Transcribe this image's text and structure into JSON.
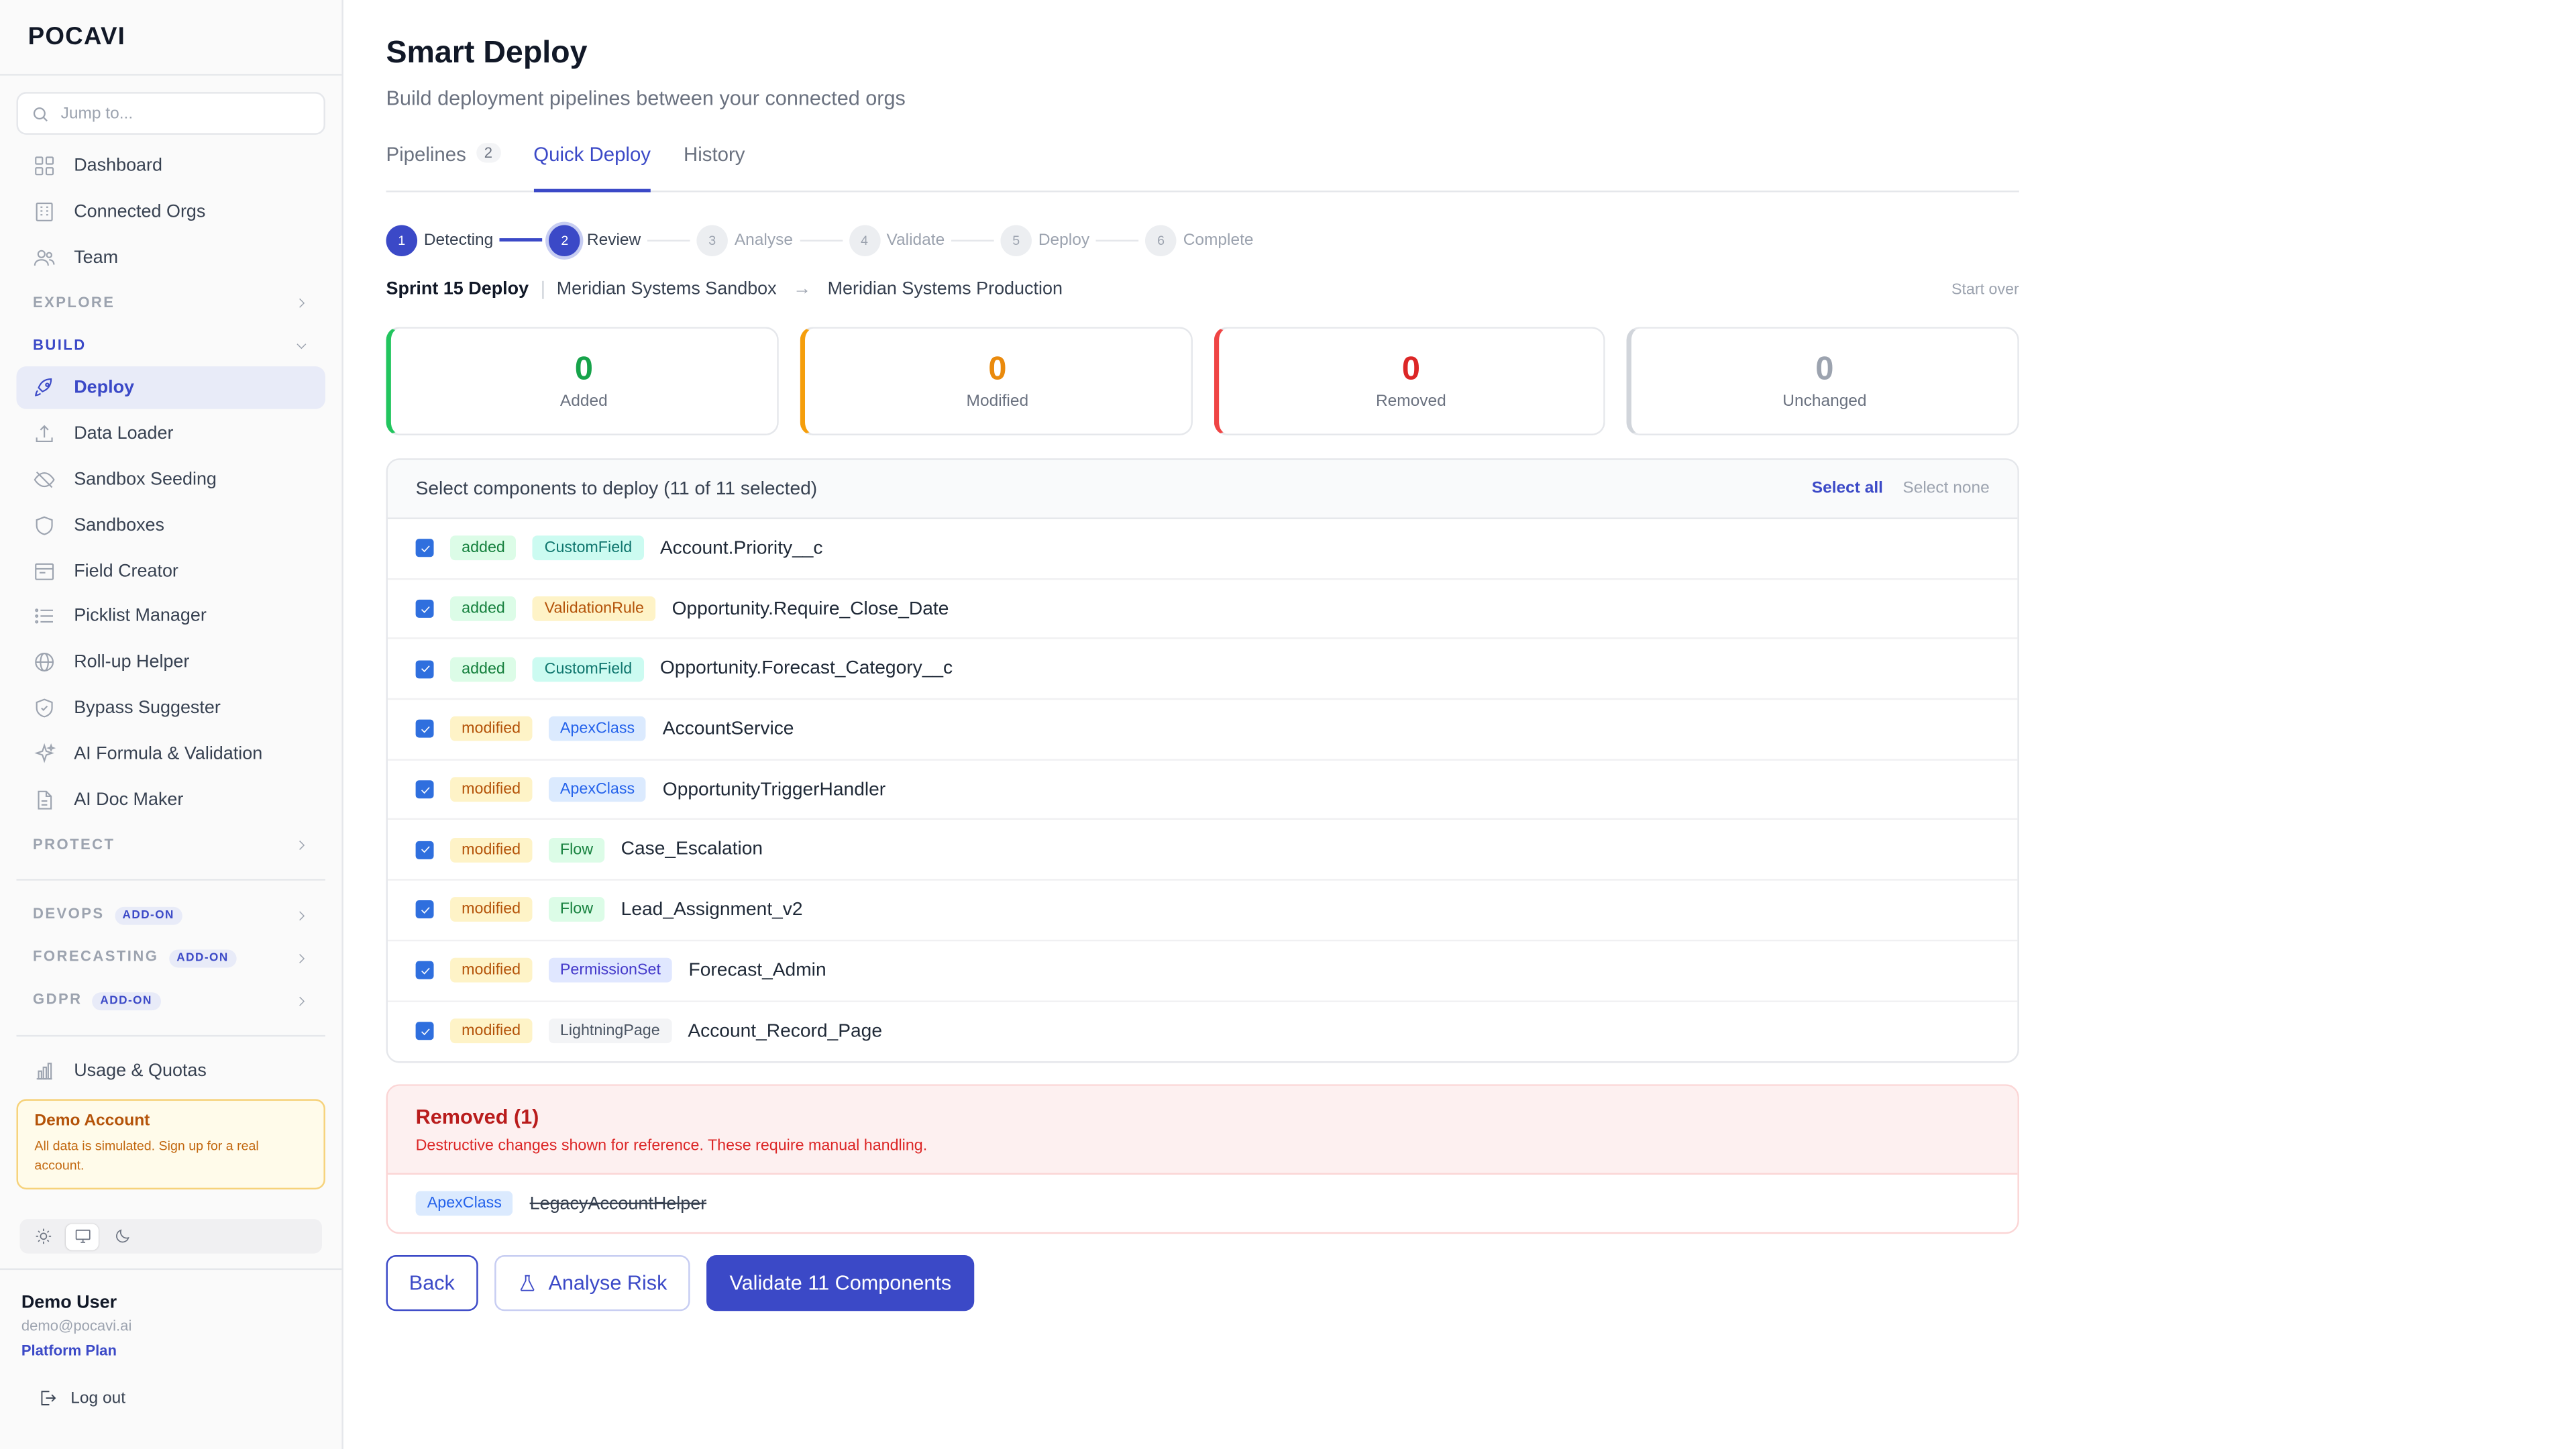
{
  "sidebar": {
    "logo": "POCAVI",
    "search_placeholder": "Jump to...",
    "top_items": [
      {
        "label": "Dashboard",
        "icon": "grid-icon"
      },
      {
        "label": "Connected Orgs",
        "icon": "building-icon"
      },
      {
        "label": "Team",
        "icon": "users-icon"
      }
    ],
    "explore_label": "EXPLORE",
    "build_label": "BUILD",
    "build_items": [
      {
        "label": "Deploy",
        "icon": "rocket-icon",
        "active": true
      },
      {
        "label": "Data Loader",
        "icon": "upload-icon"
      },
      {
        "label": "Sandbox Seeding",
        "icon": "eye-off-icon"
      },
      {
        "label": "Sandboxes",
        "icon": "shield-icon"
      },
      {
        "label": "Field Creator",
        "icon": "form-icon"
      },
      {
        "label": "Picklist Manager",
        "icon": "list-icon"
      },
      {
        "label": "Roll-up Helper",
        "icon": "globe-icon"
      },
      {
        "label": "Bypass Suggester",
        "icon": "shield-check-icon"
      },
      {
        "label": "AI Formula & Validation",
        "icon": "sparkles-icon"
      },
      {
        "label": "AI Doc Maker",
        "icon": "document-icon"
      }
    ],
    "protect_label": "PROTECT",
    "addon_sections": [
      {
        "label": "DEVOPS",
        "badge": "ADD-ON"
      },
      {
        "label": "FORECASTING",
        "badge": "ADD-ON"
      },
      {
        "label": "GDPR",
        "badge": "ADD-ON"
      }
    ],
    "usage_label": "Usage & Quotas",
    "demo": {
      "title": "Demo Account",
      "text": "All data is simulated. Sign up for a real account."
    },
    "user": {
      "name": "Demo User",
      "email": "demo@pocavi.ai",
      "plan": "Platform Plan"
    },
    "logout_label": "Log out"
  },
  "header": {
    "title": "Smart Deploy",
    "subtitle": "Build deployment pipelines between your connected orgs"
  },
  "tabs": [
    {
      "label": "Pipelines",
      "count": "2"
    },
    {
      "label": "Quick Deploy",
      "active": true
    },
    {
      "label": "History"
    }
  ],
  "steps": [
    {
      "num": "1",
      "label": "Detecting",
      "state": "done"
    },
    {
      "num": "2",
      "label": "Review",
      "state": "current"
    },
    {
      "num": "3",
      "label": "Analyse",
      "state": "pending"
    },
    {
      "num": "4",
      "label": "Validate",
      "state": "pending"
    },
    {
      "num": "5",
      "label": "Deploy",
      "state": "pending"
    },
    {
      "num": "6",
      "label": "Complete",
      "state": "pending"
    }
  ],
  "deploy": {
    "name": "Sprint 15 Deploy",
    "source": "Meridian Systems Sandbox",
    "target": "Meridian Systems Production",
    "start_over": "Start over"
  },
  "stats": [
    {
      "value": "0",
      "label": "Added",
      "color": "#16a34a"
    },
    {
      "value": "0",
      "label": "Modified",
      "color": "#ea8a0c"
    },
    {
      "value": "0",
      "label": "Removed",
      "color": "#dc2626"
    },
    {
      "value": "0",
      "label": "Unchanged",
      "color": "#9ca3af"
    }
  ],
  "components": {
    "heading": "Select components to deploy (11 of 11 selected)",
    "select_all": "Select all",
    "select_none": "Select none",
    "rows": [
      {
        "change": "added",
        "type": "CustomField",
        "name": "Account.Priority__c"
      },
      {
        "change": "added",
        "type": "ValidationRule",
        "name": "Opportunity.Require_Close_Date"
      },
      {
        "change": "added",
        "type": "CustomField",
        "name": "Opportunity.Forecast_Category__c"
      },
      {
        "change": "modified",
        "type": "ApexClass",
        "name": "AccountService"
      },
      {
        "change": "modified",
        "type": "ApexClass",
        "name": "OpportunityTriggerHandler"
      },
      {
        "change": "modified",
        "type": "Flow",
        "name": "Case_Escalation"
      },
      {
        "change": "modified",
        "type": "Flow",
        "name": "Lead_Assignment_v2"
      },
      {
        "change": "modified",
        "type": "PermissionSet",
        "name": "Forecast_Admin"
      },
      {
        "change": "modified",
        "type": "LightningPage",
        "name": "Account_Record_Page"
      }
    ]
  },
  "removed": {
    "title": "Removed (1)",
    "description": "Destructive changes shown for reference. These require manual handling.",
    "items": [
      {
        "type": "ApexClass",
        "name": "LegacyAccountHelper"
      }
    ]
  },
  "actions": {
    "back": "Back",
    "analyse": "Analyse Risk",
    "validate": "Validate 11 Components"
  }
}
